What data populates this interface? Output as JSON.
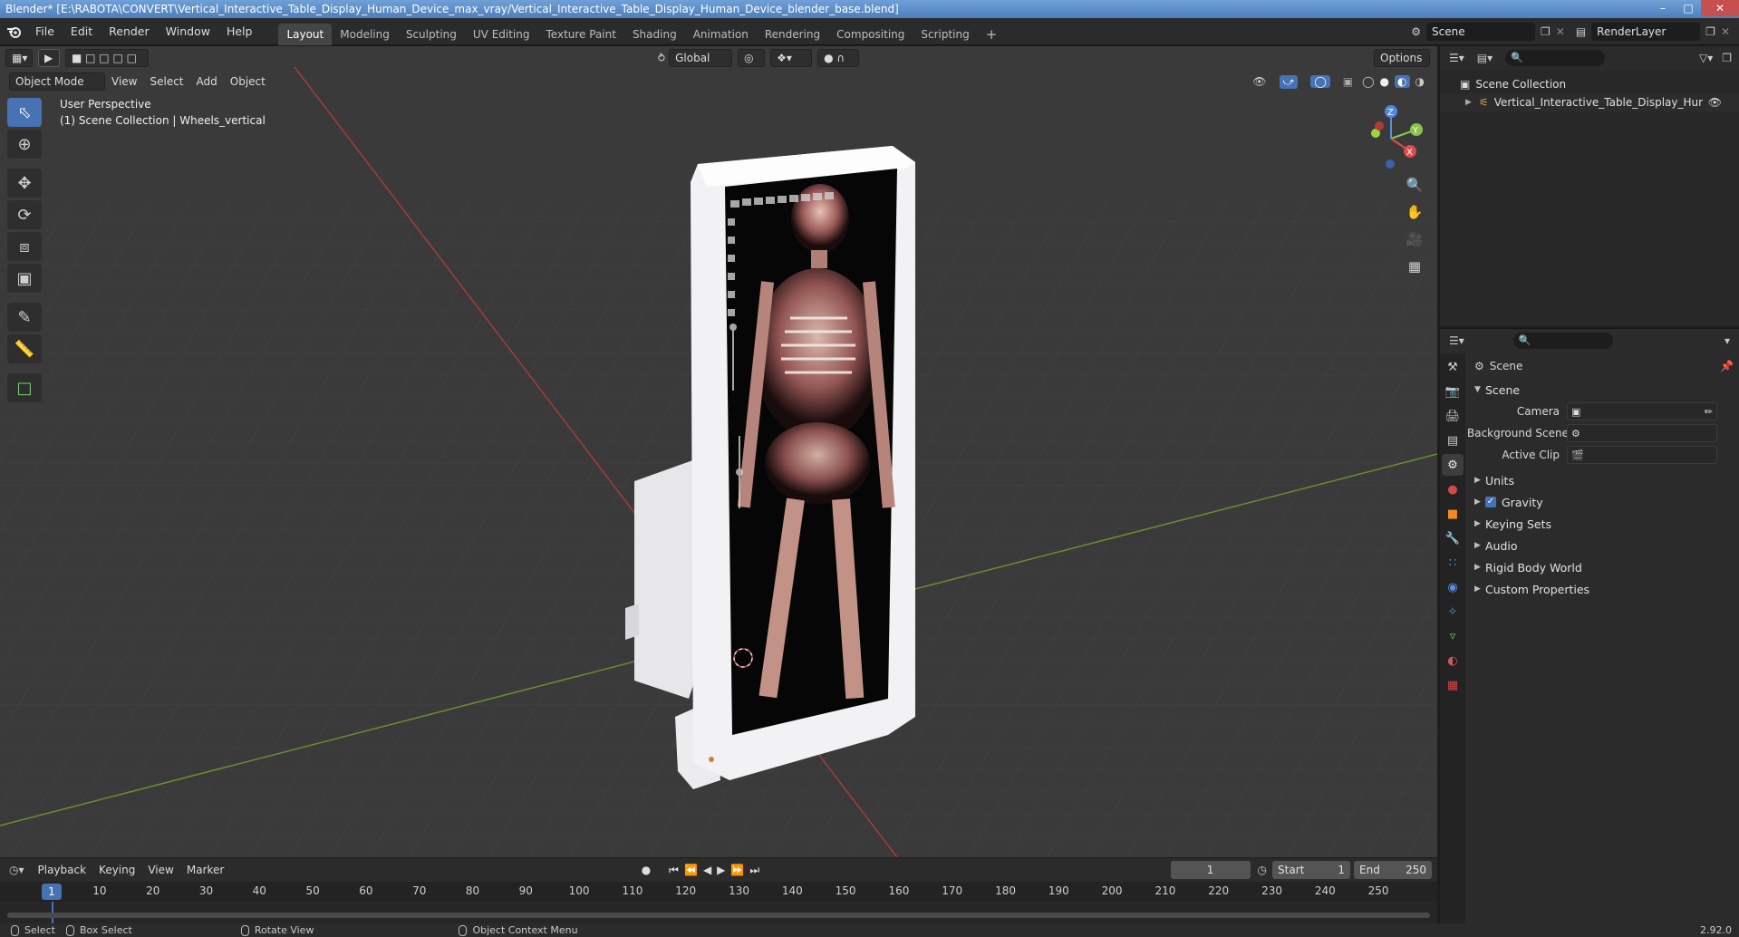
{
  "window": {
    "title": "Blender* [E:\\RABOTA\\CONVERT\\Vertical_Interactive_Table_Display_Human_Device_max_vray/Vertical_Interactive_Table_Display_Human_Device_blender_base.blend]",
    "minimize": "–",
    "maximize": "□",
    "close": "✕"
  },
  "menu": [
    "File",
    "Edit",
    "Render",
    "Window",
    "Help"
  ],
  "workspaces": [
    "Layout",
    "Modeling",
    "Sculpting",
    "UV Editing",
    "Texture Paint",
    "Shading",
    "Animation",
    "Rendering",
    "Compositing",
    "Scripting"
  ],
  "add_workspace": "+",
  "scene_selector": {
    "scene": "Scene",
    "view_layer": "RenderLayer"
  },
  "viewport": {
    "mode": "Object Mode",
    "menus": [
      "View",
      "Select",
      "Add",
      "Object"
    ],
    "orientation": "Global",
    "options": "Options",
    "overlay_line1": "User Perspective",
    "overlay_line2": "(1) Scene Collection | Wheels_vertical",
    "gizmo": {
      "x": "X",
      "y": "Y",
      "z": "Z"
    }
  },
  "outliner": {
    "root": "Scene Collection",
    "items": [
      {
        "label": "Vertical_Interactive_Table_Display_Human_l"
      }
    ]
  },
  "properties": {
    "context": "Scene",
    "panel": "Scene",
    "fields": [
      {
        "label": "Camera"
      },
      {
        "label": "Background Scene"
      },
      {
        "label": "Active Clip"
      }
    ],
    "subpanels": [
      "Units",
      "Gravity",
      "Keying Sets",
      "Audio",
      "Rigid Body World",
      "Custom Properties"
    ]
  },
  "timeline": {
    "menus": [
      "Playback",
      "Keying",
      "View",
      "Marker"
    ],
    "current_frame": "1",
    "start_label": "Start",
    "start": "1",
    "end_label": "End",
    "end": "250",
    "ticks": [
      "1",
      "10",
      "20",
      "30",
      "40",
      "50",
      "60",
      "70",
      "80",
      "90",
      "100",
      "110",
      "120",
      "130",
      "140",
      "150",
      "160",
      "170",
      "180",
      "190",
      "200",
      "210",
      "220",
      "230",
      "240",
      "250"
    ]
  },
  "statusbar": {
    "select": "Select",
    "box_select": "Box Select",
    "rotate_view": "Rotate View",
    "context_menu": "Object Context Menu",
    "version": "2.92.0"
  }
}
